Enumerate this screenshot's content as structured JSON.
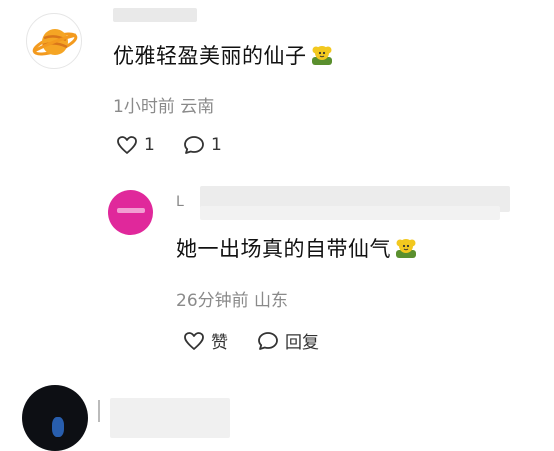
{
  "comments": [
    {
      "text": "优雅轻盈美丽的仙子",
      "time": "1小时前",
      "location": "云南",
      "likes": "1",
      "replies": "1",
      "avatar_icon": "planet-icon"
    },
    {
      "initial": "L",
      "text": "她一出场真的自带仙气",
      "time": "26分钟前",
      "location": "山东",
      "like_label": "赞",
      "reply_label": "回复",
      "avatar_color": "#e0289b"
    }
  ],
  "emoji_icon": "flower-emoji-icon",
  "colors": {
    "meta_text": "#8a8a8a",
    "body_text": "#111111",
    "emoji_green": "#5a8f2e",
    "emoji_yellow": "#f2c81f"
  }
}
